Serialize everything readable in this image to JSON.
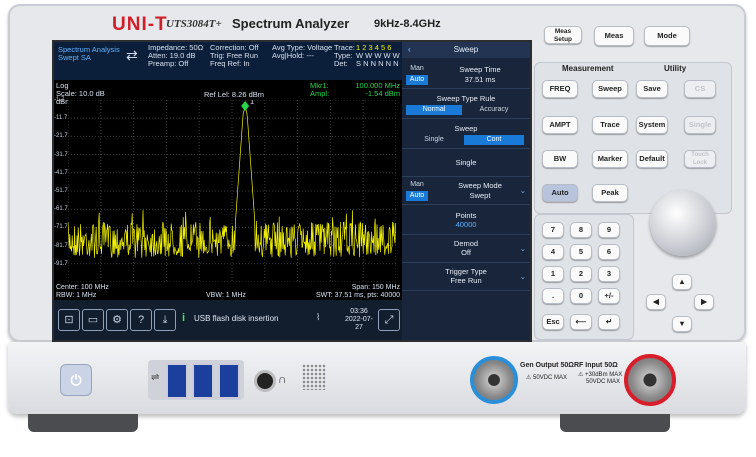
{
  "brand": {
    "logo": "UNI-T",
    "model": "UTS3084T+",
    "product": "Spectrum Analyzer",
    "range": "9kHz-8.4GHz"
  },
  "screen": {
    "mode": {
      "line1": "Spectrum Analysis",
      "line2": "Swept SA"
    },
    "params": {
      "impedance": "Impedance: 50Ω",
      "atten": "Atten: 19.0 dB",
      "preamp": "Preamp: Off",
      "correction": "Correction: Off",
      "trig": "Trig: Free Run",
      "freqref": "Freq Ref: In",
      "avgtype": "Avg Type: Voltage",
      "avghold": "Avg|Hold: ---"
    },
    "trace_legend": {
      "trace": "Trace:",
      "type": "Type:",
      "det": "Det:",
      "trace_nums": "1 2 3 4 5 6",
      "type_vals": "W W W W W W",
      "det_vals": "S N N N N N"
    },
    "scale": {
      "log": "Log",
      "scale": "Scale: 10.0 dB",
      "reflevel": "Ref Lel: 8.26 dBm",
      "unit": "dBm"
    },
    "marker": {
      "label1": "Mkr1:",
      "freq": "100.000 MHz",
      "label2": "Ampl:",
      "ampl": "-1.54 dBm",
      "id": "1"
    },
    "y_ticks": [
      "-1.7",
      "-11.7",
      "-21.7",
      "-31.7",
      "-41.7",
      "-51.7",
      "-61.7",
      "-71.7",
      "-81.7",
      "-91.7"
    ],
    "bottom": {
      "center": "Center: 100 MHz",
      "span": "Span: 150 MHz",
      "rbw": "RBW: 1 MHz",
      "vbw": "VBW: 1 MHz",
      "swt": "SWT: 37.51 ms, pts: 40000"
    },
    "status": {
      "message": "USB flash disk insertion",
      "time": "03:36",
      "date": "2022-07-27"
    },
    "menu": {
      "title": "Sweep",
      "sweep_time": {
        "label": "Sweep Time",
        "value": "37.51 ms",
        "man": "Man",
        "auto": "Auto"
      },
      "sweep_type_rule": {
        "label": "Sweep Type Rule",
        "opt1": "Normal",
        "opt2": "Accuracy"
      },
      "sweep": {
        "label": "Sweep",
        "opt1": "Single",
        "opt2": "Cont"
      },
      "single": "Single",
      "sweep_mode": {
        "label": "Sweep Mode",
        "value": "Swept",
        "man": "Man",
        "auto": "Auto"
      },
      "points": {
        "label": "Points",
        "value": "40000"
      },
      "demod": {
        "label": "Demod",
        "value": "Off"
      },
      "trigger": {
        "label": "Trigger Type",
        "value": "Free Run"
      }
    }
  },
  "keys": {
    "top": [
      "Meas Setup",
      "Meas",
      "Mode"
    ],
    "measurement_title": "Measurement",
    "utility_title": "Utility",
    "meas_keys": [
      "FREQ",
      "Sweep",
      "Save",
      "AMPT",
      "Trace",
      "System",
      "BW",
      "Marker",
      "Default",
      "Auto",
      "Peak"
    ],
    "utility_dim": [
      "CS",
      "Single",
      "Touch Lock"
    ],
    "numpad": [
      "7",
      "8",
      "9",
      "4",
      "5",
      "6",
      "1",
      "2",
      "3",
      ".",
      "0",
      "+/-"
    ],
    "nav": [
      "Esc"
    ]
  },
  "front": {
    "gen_output": "Gen Output 50Ω",
    "gen_warn": "50VDC MAX",
    "rf_input": "RF Input 50Ω",
    "rf_warn1": "+30dBm MAX",
    "rf_warn2": "50VDC MAX"
  },
  "colors": {
    "trace": "#f2f200",
    "marker": "#27d64a",
    "menu_active": "#1a7ad8",
    "rf_ring": "#d81e2a",
    "gen_ring": "#2a8fd8"
  }
}
